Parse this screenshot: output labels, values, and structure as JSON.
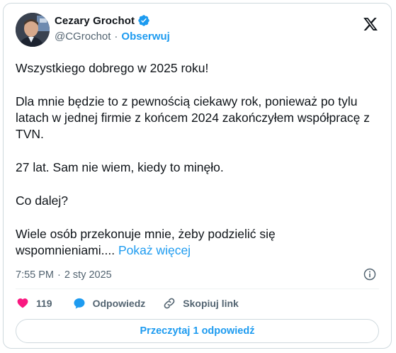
{
  "author": {
    "name": "Cezary Grochot",
    "handle": "@CGrochot",
    "separator": "·",
    "follow_label": "Obserwuj"
  },
  "tweet": {
    "paragraphs": [
      "Wszystkiego dobrego w 2025 roku!",
      "Dla mnie będzie to z pewnością ciekawy rok, ponieważ po tylu latach w jednej firmie z końcem 2024 zakończyłem współpracę z TVN.",
      "27 lat. Sam nie wiem, kiedy to minęło.",
      "Co dalej?"
    ],
    "last_paragraph": "Wiele osób przekonuje mnie, żeby podzielić się wspomnieniami....",
    "show_more_label": "Pokaż więcej"
  },
  "meta": {
    "time": "7:55 PM",
    "separator": "·",
    "date": "2 sty 2025"
  },
  "actions": {
    "likes_count": "119",
    "reply_label": "Odpowiedz",
    "copy_link_label": "Skopiuj link"
  },
  "read_replies_label": "Przeczytaj 1 odpowiedź",
  "colors": {
    "accent": "#1d9bf0",
    "like": "#f91880",
    "text": "#0f1419",
    "secondary": "#536471",
    "border": "#cfd9de"
  }
}
